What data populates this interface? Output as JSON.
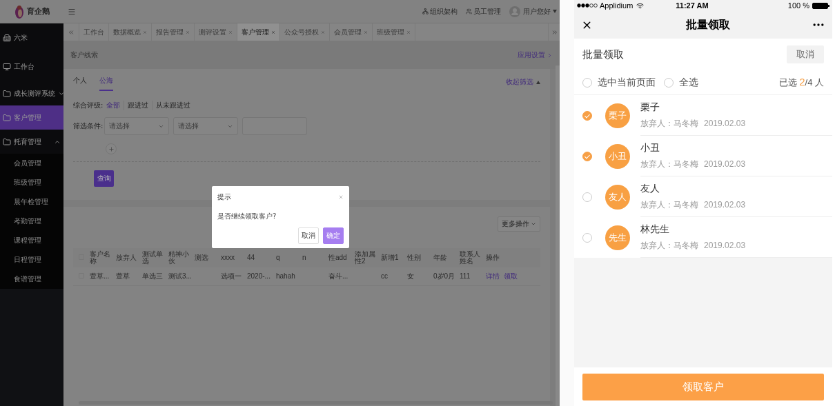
{
  "header": {
    "logo": "育企鹅",
    "links": [
      "组织架构",
      "员工管理"
    ],
    "user": "用户您好"
  },
  "sidebar": {
    "items": [
      {
        "label": "六米",
        "kind": "org",
        "selected": false
      },
      {
        "label": "工作台",
        "kind": "page",
        "selected": false
      },
      {
        "label": "成长测评系统",
        "kind": "group",
        "selected": false,
        "expanded": false
      },
      {
        "label": "客户管理",
        "kind": "group",
        "selected": true
      },
      {
        "label": "托育管理",
        "kind": "group",
        "selected": false,
        "expanded": true,
        "children": [
          {
            "label": "会员管理"
          },
          {
            "label": "班级管理"
          },
          {
            "label": "晨午检管理"
          },
          {
            "label": "考勤管理"
          },
          {
            "label": "课程管理"
          },
          {
            "label": "日程管理"
          },
          {
            "label": "食谱管理"
          }
        ]
      }
    ]
  },
  "tabs": [
    {
      "label": "工作台",
      "closable": false,
      "selected": false
    },
    {
      "label": "数据概览",
      "closable": true,
      "selected": false
    },
    {
      "label": "报告管理",
      "closable": true,
      "selected": false
    },
    {
      "label": "测评设置",
      "closable": true,
      "selected": false
    },
    {
      "label": "客户管理",
      "closable": true,
      "selected": true
    },
    {
      "label": "公众号授权",
      "closable": true,
      "selected": false
    },
    {
      "label": "会员管理",
      "closable": true,
      "selected": false
    },
    {
      "label": "班级管理",
      "closable": true,
      "selected": false
    }
  ],
  "page": {
    "breadcrumb": "客户线索",
    "settings_link": "应用设置"
  },
  "filter_panel": {
    "tabs": [
      {
        "label": "个人",
        "selected": false
      },
      {
        "label": "公海",
        "selected": true
      }
    ],
    "collapse_link": "收起筛选",
    "rating": {
      "label": "综合评级:",
      "options": [
        {
          "label": "全部",
          "selected": true
        },
        {
          "label": "跟进过",
          "selected": false
        },
        {
          "label": "从未跟进过",
          "selected": false
        }
      ]
    },
    "conditions": {
      "label": "筛选条件:",
      "selects": [
        {
          "placeholder": "请选择"
        },
        {
          "placeholder": "请选择"
        }
      ]
    },
    "query_button": "查询"
  },
  "table": {
    "more_button": "更多操作",
    "header_checked": false,
    "columns": [
      "客户名称",
      "放弃人",
      "测试单选",
      "精神小伙",
      "测选",
      "xxxx",
      "44",
      "q",
      "n",
      "性add",
      "添加属性2",
      "新增1",
      "性别",
      "年龄",
      "联系人姓名",
      "操作"
    ],
    "rows": [
      {
        "checked": false,
        "cells": [
          "萱草...",
          "萱草",
          "单选三",
          "测试3...",
          null,
          "选项一",
          "2020-...",
          "hahah",
          null,
          "奋斗...",
          null,
          "cc",
          "女",
          "0岁0月",
          "111"
        ],
        "actions": [
          "详情",
          "领取"
        ]
      }
    ]
  },
  "dialog": {
    "title": "提示",
    "message": "是否继续领取客户?",
    "buttons": [
      {
        "label": "取消",
        "kind": "default"
      },
      {
        "label": "确定",
        "kind": "primary"
      }
    ]
  },
  "phone": {
    "status": {
      "carrier": "Applidium",
      "time": "11:27 AM",
      "battery": "100 %"
    },
    "nav_title": "批量领取",
    "section": {
      "title": "批量领取",
      "cancel": "取消"
    },
    "select_options": [
      {
        "label": "选中当前页面",
        "selected": false
      },
      {
        "label": "全选",
        "selected": false
      }
    ],
    "count": {
      "prefix": "已选",
      "selected": "2",
      "total": "/4",
      "suffix": "人"
    },
    "customers": [
      {
        "name": "栗子",
        "avatar": "栗子",
        "abandoner": "放弃人：马冬梅",
        "date": "2019.02.03",
        "checked": true
      },
      {
        "name": "小丑",
        "avatar": "小丑",
        "abandoner": "放弃人：马冬梅",
        "date": "2019.02.03",
        "checked": true
      },
      {
        "name": "友人",
        "avatar": "友人",
        "abandoner": "放弃人：马冬梅",
        "date": "2019.02.03",
        "checked": false
      },
      {
        "name": "林先生",
        "avatar": "先生",
        "abandoner": "放弃人：马冬梅",
        "date": "2019.02.03",
        "checked": false
      }
    ],
    "submit": "领取客户"
  }
}
